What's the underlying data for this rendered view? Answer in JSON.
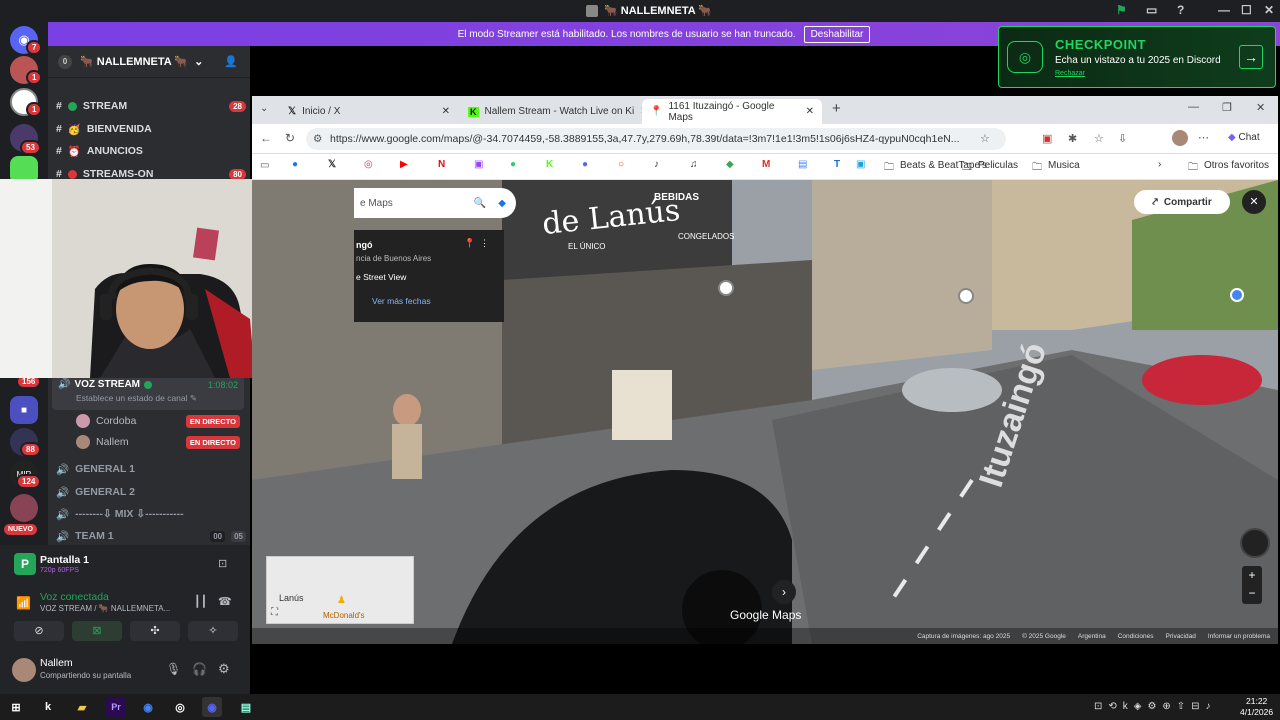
{
  "window": {
    "title": "🐂 NALLEMNETA 🐂"
  },
  "banner": {
    "text": "El modo Streamer está habilitado. Los nombres de usuario se han truncado.",
    "button": "Deshabilitar"
  },
  "checkpoint": {
    "title": "CHECKPOINT",
    "subtitle": "Echa un vistazo a tu 2025 en Discord",
    "dismiss": "Rechazar"
  },
  "rail": {
    "badges": [
      "7",
      "1",
      "1",
      "53",
      "156",
      "88",
      "124"
    ],
    "new_label": "NUEVO"
  },
  "server": {
    "name": "🐂 NALLEMNETA 🐂",
    "voice_count_badge": "0"
  },
  "channels": [
    {
      "name": "STREAM",
      "count": "28"
    },
    {
      "name": "BIENVENIDA",
      "count": ""
    },
    {
      "name": "ANUNCIOS",
      "count": ""
    },
    {
      "name": "STREAMS-ON",
      "count": "80"
    }
  ],
  "voice": {
    "name": "VOZ STREAM",
    "timer": "1:08:02",
    "status_hint": "Establece un estado de canal",
    "members": [
      {
        "name": "Cordoba",
        "tag": "EN DIRECTO"
      },
      {
        "name": "Nallem",
        "tag": "EN DIRECTO"
      }
    ],
    "others": [
      "GENERAL 1",
      "GENERAL 2",
      "--------⇩ MIX ⇩-----------",
      "TEAM 1"
    ],
    "team_counts": [
      "00",
      "05"
    ]
  },
  "screenshare": {
    "title": "Pantalla 1",
    "quality": "720p 60FPS"
  },
  "connection": {
    "status": "Voz conectada",
    "channel": "VOZ STREAM / 🐂 NALLEMNETA..."
  },
  "user": {
    "name": "Nallem",
    "status": "Compartiendo su pantalla"
  },
  "browser": {
    "tabs": [
      {
        "label": "Inicio / X"
      },
      {
        "label": "Nallem Stream - Watch Live on Ki"
      },
      {
        "label": "1161 Ituzaingó - Google Maps"
      }
    ],
    "url": "https://www.google.com/maps/@-34.7074459,-58.3889155,3a,47.7y,279.69h,78.39t/data=!3m7!1e1!3m5!1s06j6sHZ4-qypuN0cqh1eN...",
    "chat_label": "Chat",
    "bookmark_folders": [
      "Beats & BeatTape's",
      "Peliculas",
      "Musica"
    ],
    "other_favorites": "Otros favoritos"
  },
  "maps": {
    "search_placeholder": "e Maps",
    "place_title": "ngó",
    "place_sub": "ncia de Buenos Aires",
    "street_view": "e Street View",
    "more_dates": "Ver más fechas",
    "share": "Compartir",
    "street_name": "Ituzaingó",
    "brand": "Google Maps",
    "minimap_label": "Lanús",
    "minimap_poi": "McDonald's",
    "footer": [
      "Captura de imágenes: ago 2025",
      "© 2025 Google",
      "Argentina",
      "Condiciones",
      "Privacidad",
      "Informar un problema"
    ],
    "shop_signs": [
      "de Lanús",
      "BEBIDAS",
      "CONGELADOS",
      "EL ÚNICO"
    ]
  },
  "taskbar": {
    "time": "21:22",
    "date": "4/1/2026"
  }
}
